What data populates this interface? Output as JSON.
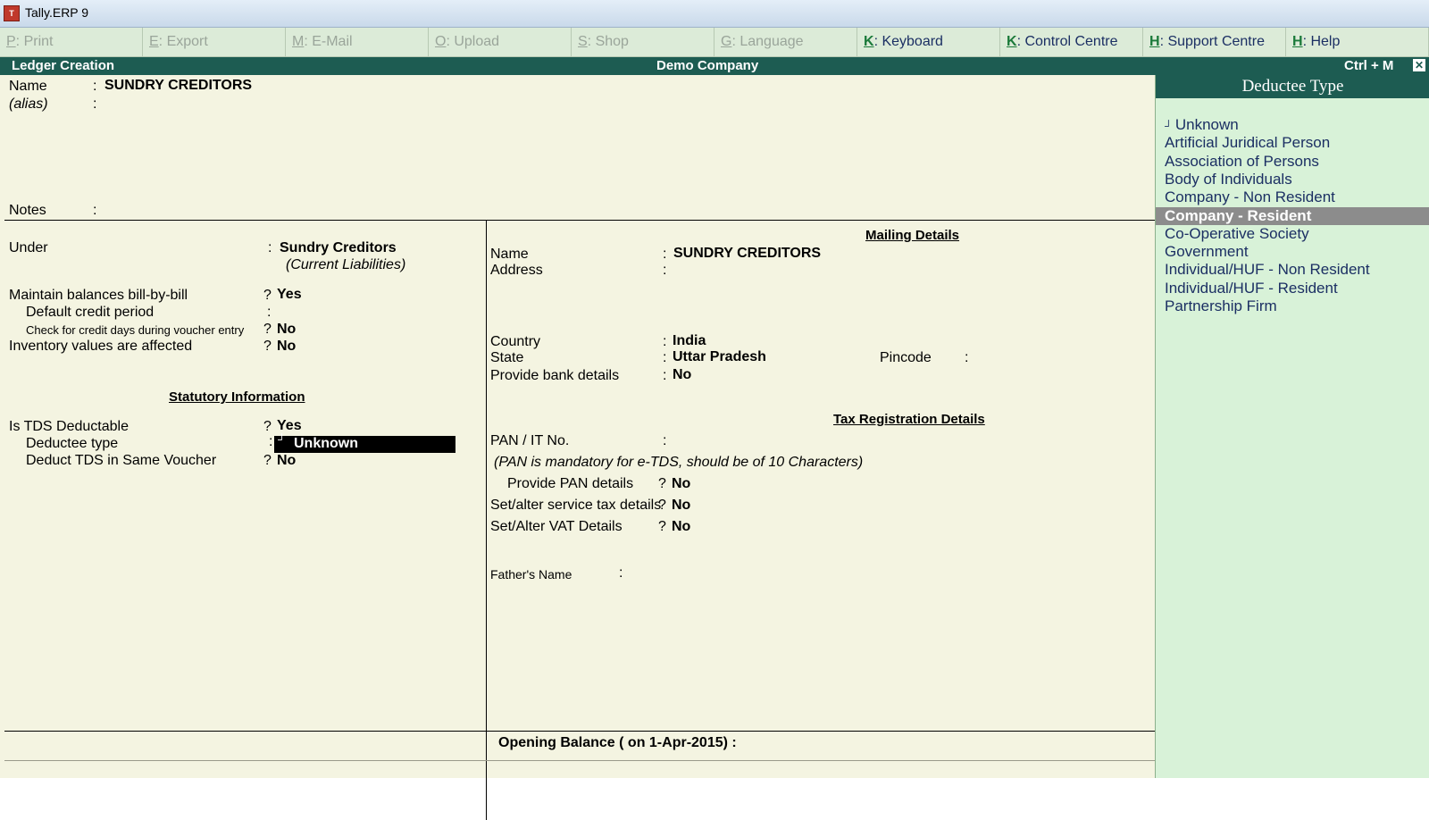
{
  "window": {
    "title": "Tally.ERP 9",
    "icon_name": "tally-app-icon"
  },
  "toolbar": [
    {
      "key": "P",
      "label": ": Print",
      "enabled": false
    },
    {
      "key": "E",
      "label": ": Export",
      "enabled": false
    },
    {
      "key": "M",
      "label": ": E-Mail",
      "enabled": false
    },
    {
      "key": "O",
      "label": ": Upload",
      "enabled": false
    },
    {
      "key": "S",
      "label": ": Shop",
      "enabled": false
    },
    {
      "key": "G",
      "label": ": Language",
      "enabled": false
    },
    {
      "key": "K",
      "label": ": Keyboard",
      "enabled": true
    },
    {
      "key": "K",
      "label": ": Control Centre",
      "enabled": true
    },
    {
      "key": "H",
      "label": ": Support Centre",
      "enabled": true
    },
    {
      "key": "H",
      "label": ": Help",
      "enabled": true
    }
  ],
  "header": {
    "screen_title": "Ledger Creation",
    "company": "Demo Company",
    "shortcut": "Ctrl + M"
  },
  "ledger": {
    "name_label": "Name",
    "name_value": "SUNDRY CREDITORS",
    "alias_label": "(alias)",
    "notes_label": "Notes",
    "under_label": "Under",
    "under_value": "Sundry Creditors",
    "under_group": "(Current Liabilities)",
    "billwise_label": "Maintain balances bill-by-bill",
    "billwise_value": "Yes",
    "credit_period_label": "Default credit period",
    "credit_days_label": "Check for credit days during voucher entry",
    "credit_days_value": "No",
    "inventory_label": "Inventory values are affected",
    "inventory_value": "No",
    "statutory_heading": "Statutory Information",
    "tds_label": "Is TDS Deductable",
    "tds_value": "Yes",
    "deductee_label": "Deductee type",
    "deductee_value": "Unknown",
    "tds_same_label": "Deduct TDS in Same Voucher",
    "tds_same_value": "No"
  },
  "mailing": {
    "heading": "Mailing Details",
    "name_label": "Name",
    "name_value": "SUNDRY CREDITORS",
    "address_label": "Address",
    "country_label": "Country",
    "country_value": "India",
    "state_label": "State",
    "state_value": "Uttar Pradesh",
    "pincode_label": "Pincode",
    "bank_label": "Provide bank details",
    "bank_value": "No"
  },
  "tax": {
    "heading": "Tax Registration Details",
    "pan_label": "PAN / IT No.",
    "pan_note": "(PAN is mandatory for e-TDS, should be of 10 Characters)",
    "pan_details_label": "Provide PAN details",
    "pan_details_value": "No",
    "service_tax_label": "Set/alter service tax details",
    "service_tax_value": "No",
    "vat_label": "Set/Alter VAT Details",
    "vat_value": "No",
    "father_label": "Father's Name"
  },
  "footer": {
    "opening_balance": "Opening Balance   ( on 1-Apr-2015) :"
  },
  "side": {
    "title": "Deductee Type",
    "items": [
      "Unknown",
      "Artificial Juridical Person",
      "Association of Persons",
      "Body of Individuals",
      "Company - Non Resident",
      "Company - Resident",
      "Co-Operative Society",
      "Government",
      "Individual/HUF - Non Resident",
      "Individual/HUF - Resident",
      "Partnership Firm"
    ],
    "selected_index": 5
  }
}
